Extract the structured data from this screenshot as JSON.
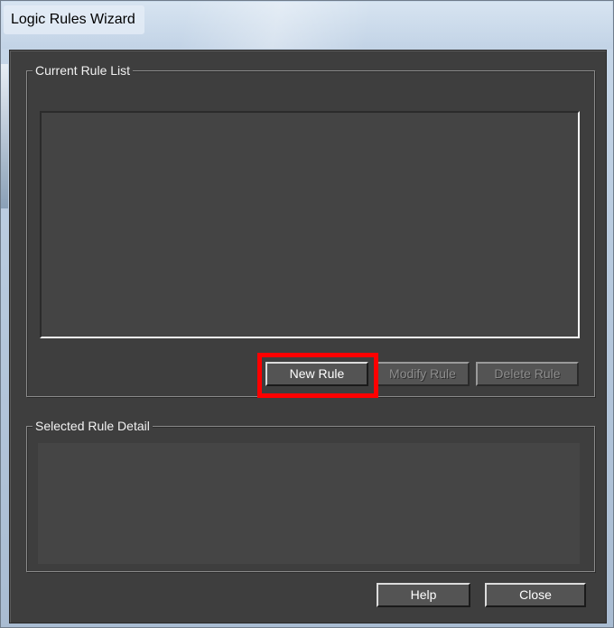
{
  "window": {
    "title": "Logic Rules Wizard"
  },
  "current_rule_list": {
    "legend": "Current Rule List",
    "items": []
  },
  "buttons": {
    "new_rule": "New Rule",
    "modify_rule": "Modify Rule",
    "delete_rule": "Delete Rule",
    "help": "Help",
    "close": "Close"
  },
  "selected_rule_detail": {
    "legend": "Selected Rule Detail",
    "text": ""
  },
  "colors": {
    "background": "#3e3e3e",
    "highlight": "#ff0000"
  }
}
